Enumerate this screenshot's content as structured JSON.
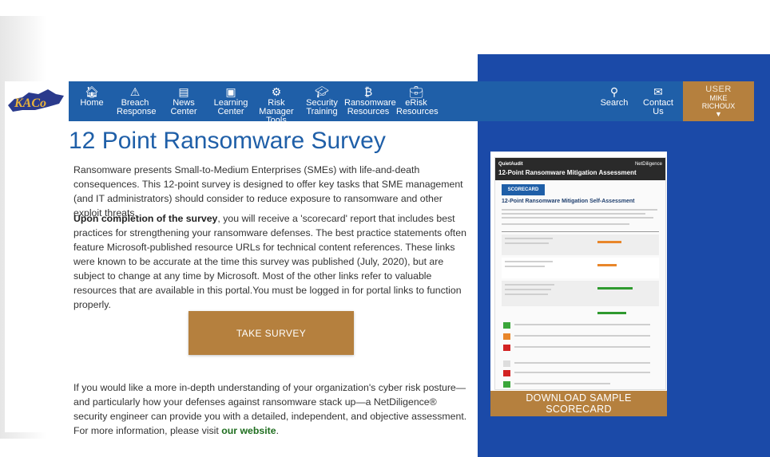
{
  "brand": {
    "logo_text": "KACo"
  },
  "nav": {
    "items": [
      {
        "label": "Home"
      },
      {
        "label": "Breach Response"
      },
      {
        "label": "News Center"
      },
      {
        "label": "Learning Center"
      },
      {
        "label": "Risk Manager Tools"
      },
      {
        "label": "Security Training"
      },
      {
        "label": "Ransomware Resources"
      },
      {
        "label": "eRisk Resources"
      }
    ],
    "search_label": "Search",
    "contact_label": "Contact Us",
    "user_label": "USER",
    "user_name": "MIKE RICHOUX"
  },
  "main": {
    "title": "12 Point Ransomware Survey",
    "para1": "Ransomware presents Small-to-Medium Enterprises (SMEs) with life-and-death consequences. This 12-point survey is designed to offer key tasks that SME management (and IT administrators) should consider to reduce exposure to ransomware and other exploit threats.",
    "para2_bold": "Upon completion of the survey",
    "para2_rest": ", you will receive a 'scorecard' report that includes best practices for strengthening your ransomware defenses. The best practice statements often feature Microsoft-published resource URLs for technical content references. These links were known to be accurate at the time this survey was published (July, 2020), but are subject to change at any time by Microsoft. Most of the other links refer to valuable resources that are available in this portal.You must be logged in for portal links to function properly.",
    "take_survey_label": "TAKE SURVEY",
    "para3": "If you would like a more in-depth understanding of your organization's cyber risk posture—and particularly how your defenses against ransomware stack up—a NetDiligence® security engineer can provide you with a detailed, independent, and objective assessment. For more information, please visit ",
    "para3_link": "our website",
    "para3_end": "."
  },
  "sample": {
    "head_brand": "QuietAudit",
    "head_title": "12-Point Ransomware Mitigation Assessment",
    "head_partner": "NetDiligence",
    "badge": "SCORECARD",
    "doc_title": "12-Point Ransomware Mitigation Self-Assessment",
    "download_label": "DOWNLOAD SAMPLE SCORECARD"
  },
  "colors": {
    "nav_blue": "#1f5fa8",
    "accent_gold": "#b5803e",
    "panel_blue": "#1b4aa8",
    "link_green": "#1f6e1f"
  }
}
